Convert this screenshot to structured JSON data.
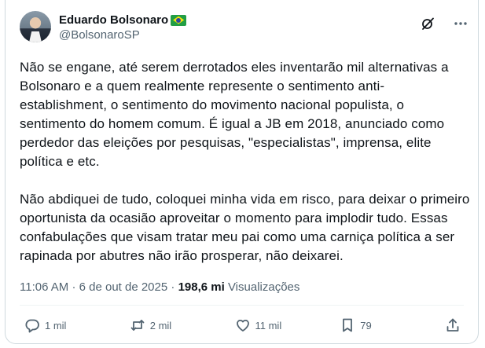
{
  "author": {
    "display_name": "Eduardo Bolsonaro",
    "flag_icon": "brazil-flag-icon",
    "handle": "@BolsonaroSP"
  },
  "header_icons": [
    "grok-icon",
    "more-icon"
  ],
  "body": {
    "paragraph_1": "Não se engane, até serem derrotados eles inventarão mil alternativas a Bolsonaro e a quem realmente represente o sentimento anti-establishment, o sentimento do movimento nacional populista, o sentimento do homem comum. É igual a JB em 2018, anunciado como perdedor das eleições por pesquisas, \"especialistas\", imprensa, elite política e etc.",
    "paragraph_2": "Não abdiquei de tudo, coloquei minha vida em risco, para deixar o primeiro oportunista da ocasião aproveitar o momento para implodir tudo. Essas confabulações que visam tratar meu pai como uma carniça política a ser rapinada por abutres não irão prosperar, não deixarei."
  },
  "meta": {
    "time": "11:06 AM",
    "separator": "·",
    "date": "6 de out de 2025",
    "views_count": "198,6 mi",
    "views_label": "Visualizações"
  },
  "actions": {
    "replies": "1 mil",
    "reposts": "2 mil",
    "likes": "11 mil",
    "bookmarks": "79"
  },
  "colors": {
    "text": "#0f1419",
    "secondary": "#536471",
    "border": "#cfd9de",
    "divider": "#eff3f4"
  }
}
